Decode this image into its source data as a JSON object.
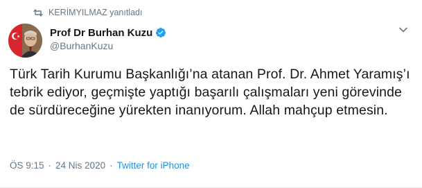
{
  "retweet": {
    "label": "KERİMYILMAZ yanıtladı",
    "icon": "retweet-icon"
  },
  "author": {
    "display_name": "Prof Dr Burhan Kuzu",
    "handle": "@BurhanKuzu",
    "verified": true,
    "verified_color": "#1da1f2"
  },
  "tweet": {
    "text": "Türk Tarih Kurumu Başkanlığı’na atanan Prof. Dr. Ahmet Yaramış’ı tebrik ediyor, geçmişte yaptığı başarılı çalışmaları yeni görevinde de sürdüreceğine yürekten inanıyorum. Allah mahçup etmesin."
  },
  "meta": {
    "time": "ÖS 9:15",
    "separator": "·",
    "date": "24 Nis 2020",
    "source": "Twitter for iPhone"
  },
  "colors": {
    "muted": "#657786",
    "link": "#1b95e0",
    "text": "#14171a"
  }
}
